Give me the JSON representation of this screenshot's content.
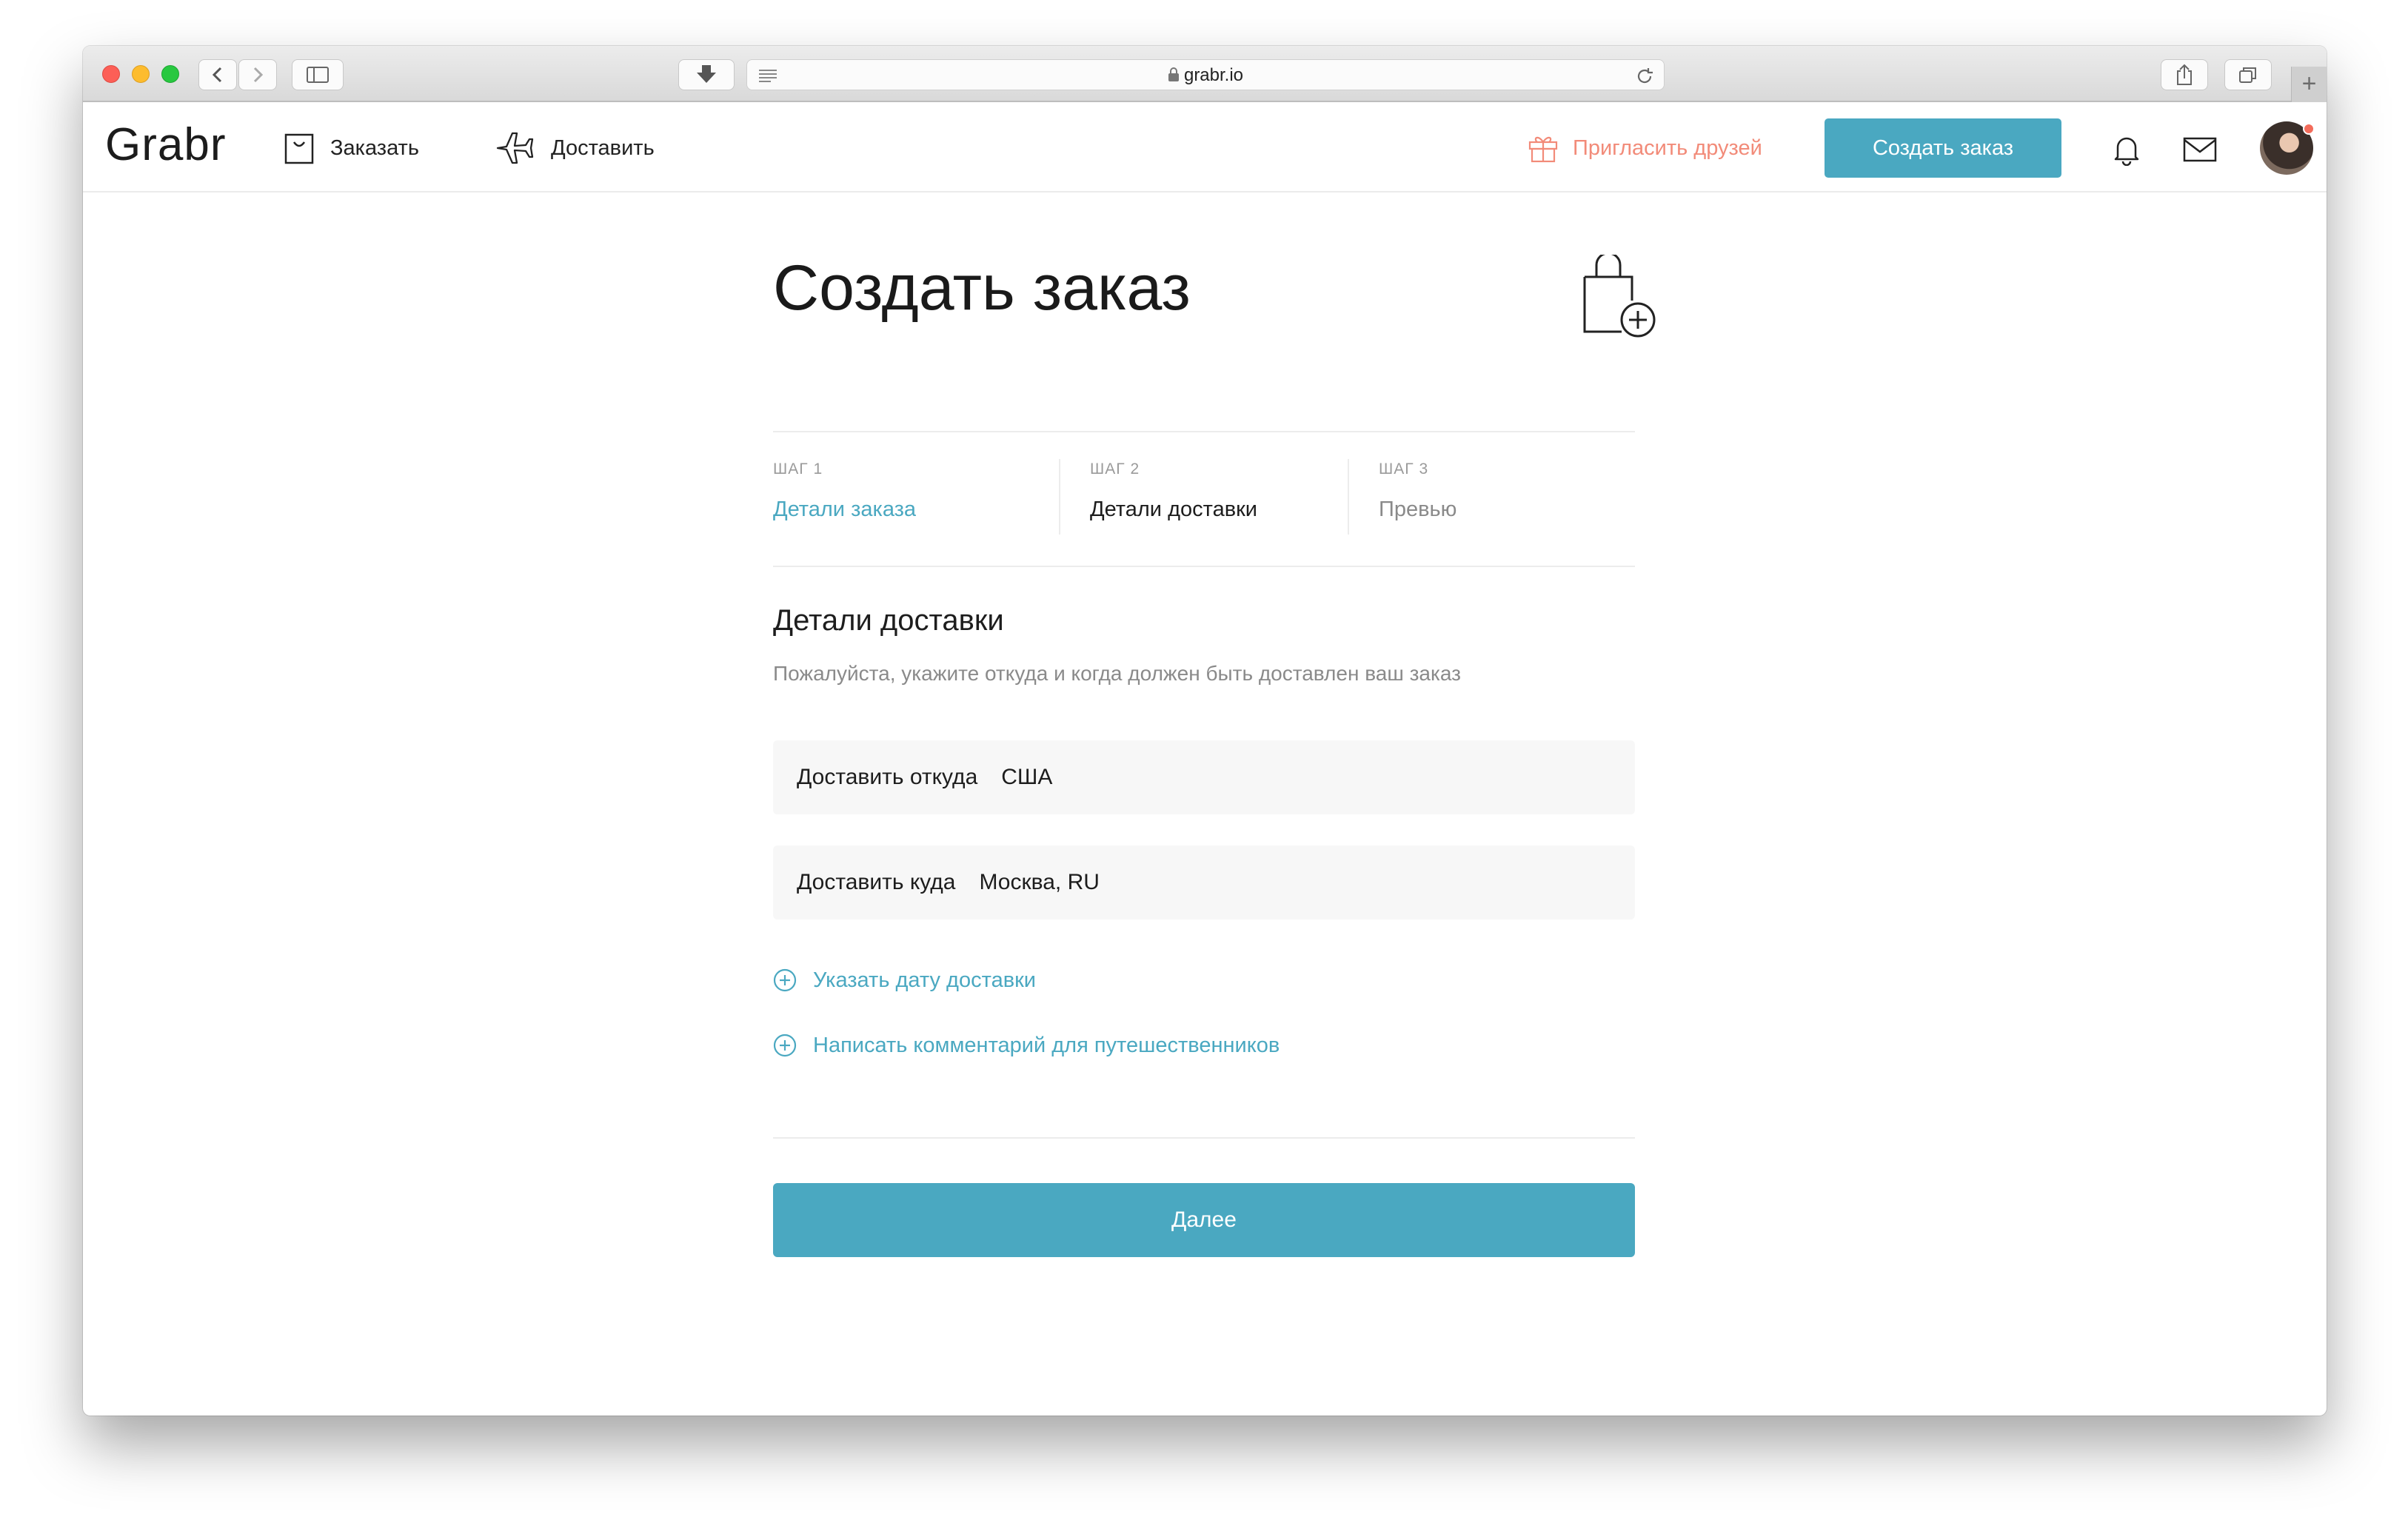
{
  "browser": {
    "url": "grabr.io",
    "icons": [
      "back-icon",
      "forward-icon",
      "sidebar-icon",
      "download-icon",
      "reader-icon",
      "lock-icon",
      "reload-icon",
      "share-icon",
      "tabs-icon",
      "new-tab-icon"
    ]
  },
  "header": {
    "logo": "Grabr",
    "nav": [
      {
        "label": "Заказать",
        "icon": "shopping-bag-icon"
      },
      {
        "label": "Доставить",
        "icon": "airplane-icon"
      }
    ],
    "invite_label": "Пригласить друзей",
    "create_order_label": "Создать заказ",
    "icons": [
      "gift-icon",
      "bell-icon",
      "mail-icon",
      "avatar"
    ]
  },
  "page": {
    "title": "Создать заказ",
    "steps": [
      {
        "num": "ШАГ 1",
        "label": "Детали заказа",
        "state": "completed"
      },
      {
        "num": "ШАГ 2",
        "label": "Детали доставки",
        "state": "active"
      },
      {
        "num": "ШАГ 3",
        "label": "Превью",
        "state": "upcoming"
      }
    ],
    "section_title": "Детали доставки",
    "section_subtitle": "Пожалуйста, укажите откуда и когда должен быть доставлен ваш заказ",
    "from_field": {
      "label": "Доставить откуда",
      "value": "США"
    },
    "to_field": {
      "label": "Доставить куда",
      "value": "Москва, RU"
    },
    "add_date_label": "Указать дату доставки",
    "add_comment_label": "Написать комментарий для путешественников",
    "next_label": "Далее"
  },
  "colors": {
    "accent": "#4aa8c1",
    "invite": "#f28b79",
    "step_completed": "#4aa8c1",
    "step_active": "#1d1d1d",
    "step_upcoming": "#8a8a8a",
    "field_bg": "#f7f7f7"
  }
}
